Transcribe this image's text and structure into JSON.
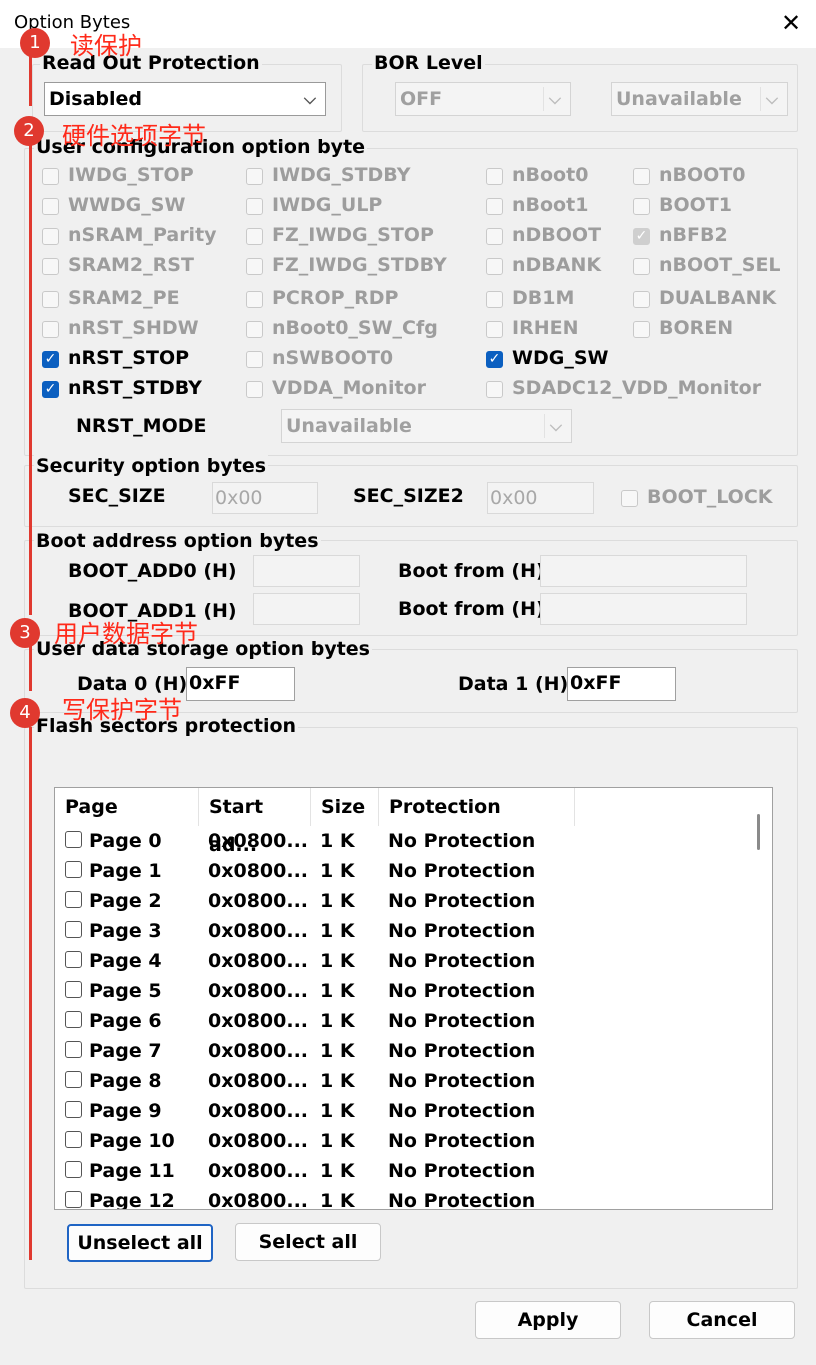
{
  "window": {
    "title": "Option Bytes",
    "close_glyph": "✕"
  },
  "read_out_protection": {
    "legend": "Read Out Protection",
    "value": "Disabled"
  },
  "bor_level": {
    "legend": "BOR Level",
    "value1": "OFF",
    "value2": "Unavailable"
  },
  "user_config": {
    "legend": "User configuration option byte",
    "options": [
      {
        "label": "IWDG_STOP",
        "checked": false,
        "enabled": false
      },
      {
        "label": "IWDG_STDBY",
        "checked": false,
        "enabled": false
      },
      {
        "label": "nBoot0",
        "checked": false,
        "enabled": false
      },
      {
        "label": "nBOOT0",
        "checked": false,
        "enabled": false
      },
      {
        "label": "WWDG_SW",
        "checked": false,
        "enabled": false
      },
      {
        "label": "IWDG_ULP",
        "checked": false,
        "enabled": false
      },
      {
        "label": "nBoot1",
        "checked": false,
        "enabled": false
      },
      {
        "label": "BOOT1",
        "checked": false,
        "enabled": false
      },
      {
        "label": "nSRAM_Parity",
        "checked": false,
        "enabled": false
      },
      {
        "label": "FZ_IWDG_STOP",
        "checked": false,
        "enabled": false
      },
      {
        "label": "nDBOOT",
        "checked": false,
        "enabled": false
      },
      {
        "label": "nBFB2",
        "checked": true,
        "enabled": false
      },
      {
        "label": "SRAM2_RST",
        "checked": false,
        "enabled": false
      },
      {
        "label": "FZ_IWDG_STDBY",
        "checked": false,
        "enabled": false
      },
      {
        "label": "nDBANK",
        "checked": false,
        "enabled": false
      },
      {
        "label": "nBOOT_SEL",
        "checked": false,
        "enabled": false
      },
      {
        "label": "SRAM2_PE",
        "checked": false,
        "enabled": false
      },
      {
        "label": "PCROP_RDP",
        "checked": false,
        "enabled": false
      },
      {
        "label": "DB1M",
        "checked": false,
        "enabled": false
      },
      {
        "label": "DUALBANK",
        "checked": false,
        "enabled": false
      },
      {
        "label": "nRST_SHDW",
        "checked": false,
        "enabled": false
      },
      {
        "label": "nBoot0_SW_Cfg",
        "checked": false,
        "enabled": false
      },
      {
        "label": "IRHEN",
        "checked": false,
        "enabled": false
      },
      {
        "label": "BOREN",
        "checked": false,
        "enabled": false
      },
      {
        "label": "nRST_STOP",
        "checked": true,
        "enabled": true
      },
      {
        "label": "nSWBOOT0",
        "checked": false,
        "enabled": false
      },
      {
        "label": "WDG_SW",
        "checked": true,
        "enabled": true
      },
      {
        "label": "nRST_STDBY",
        "checked": true,
        "enabled": true
      },
      {
        "label": "VDDA_Monitor",
        "checked": false,
        "enabled": false
      },
      {
        "label": "SDADC12_VDD_Monitor",
        "checked": false,
        "enabled": false
      }
    ],
    "nrst_mode_label": "NRST_MODE",
    "nrst_mode_value": "Unavailable"
  },
  "security": {
    "legend": "Security option bytes",
    "sec_size_label": "SEC_SIZE",
    "sec_size_value": "0x00",
    "sec_size2_label": "SEC_SIZE2",
    "sec_size2_value": "0x00",
    "boot_lock_label": "BOOT_LOCK"
  },
  "boot_address": {
    "legend": "Boot address option bytes",
    "boot_add0_label": "BOOT_ADD0 (H)",
    "boot_add0_value": "",
    "boot_add1_label": "BOOT_ADD1 (H)",
    "boot_add1_value": "",
    "boot_from_label": "Boot from (H)",
    "boot_from_value1": "",
    "boot_from_value2": ""
  },
  "user_data": {
    "legend": "User data storage option bytes",
    "data0_label": "Data 0 (H)",
    "data0_value": "0xFF",
    "data1_label": "Data 1 (H)",
    "data1_value": "0xFF"
  },
  "flash_protection": {
    "legend": "Flash sectors protection",
    "columns": [
      "Page",
      "Start ad...",
      "Size",
      "Protection"
    ],
    "rows": [
      {
        "page": "Page 0",
        "start": "0x0800...",
        "size": "1 K",
        "protection": "No Protection"
      },
      {
        "page": "Page 1",
        "start": "0x0800...",
        "size": "1 K",
        "protection": "No Protection"
      },
      {
        "page": "Page 2",
        "start": "0x0800...",
        "size": "1 K",
        "protection": "No Protection"
      },
      {
        "page": "Page 3",
        "start": "0x0800...",
        "size": "1 K",
        "protection": "No Protection"
      },
      {
        "page": "Page 4",
        "start": "0x0800...",
        "size": "1 K",
        "protection": "No Protection"
      },
      {
        "page": "Page 5",
        "start": "0x0800...",
        "size": "1 K",
        "protection": "No Protection"
      },
      {
        "page": "Page 6",
        "start": "0x0800...",
        "size": "1 K",
        "protection": "No Protection"
      },
      {
        "page": "Page 7",
        "start": "0x0800...",
        "size": "1 K",
        "protection": "No Protection"
      },
      {
        "page": "Page 8",
        "start": "0x0800...",
        "size": "1 K",
        "protection": "No Protection"
      },
      {
        "page": "Page 9",
        "start": "0x0800...",
        "size": "1 K",
        "protection": "No Protection"
      },
      {
        "page": "Page 10",
        "start": "0x0800...",
        "size": "1 K",
        "protection": "No Protection"
      },
      {
        "page": "Page 11",
        "start": "0x0800...",
        "size": "1 K",
        "protection": "No Protection"
      },
      {
        "page": "Page 12",
        "start": "0x0800...",
        "size": "1 K",
        "protection": "No Protection"
      }
    ],
    "unselect_all": "Unselect all",
    "select_all": "Select all"
  },
  "footer": {
    "apply": "Apply",
    "cancel": "Cancel"
  },
  "annotations": [
    {
      "number": "1",
      "text": "读保护"
    },
    {
      "number": "2",
      "text": "硬件选项字节"
    },
    {
      "number": "3",
      "text": "用户数据字节"
    },
    {
      "number": "4",
      "text": "写保护字节"
    }
  ],
  "colors": {
    "annotation": "#e0392f",
    "accent": "#0b5fc0"
  }
}
